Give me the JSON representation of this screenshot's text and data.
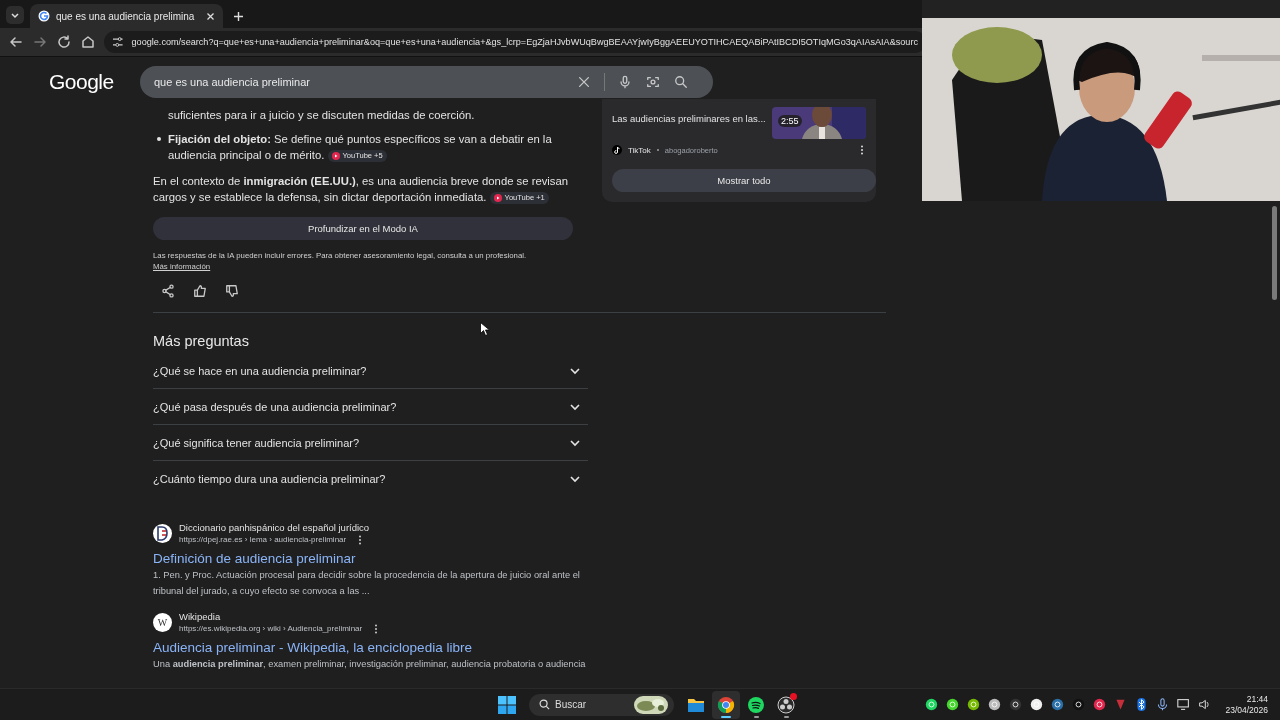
{
  "browser": {
    "tab": {
      "title": "que es una audiencia prelimina",
      "selected": true
    },
    "url": "google.com/search?q=que+es+una+audiencia+preliminar&oq=que+es+una+audiencia+&gs_lcrp=EgZjaHJvbWUqBwgBEAAYjwIyBggAEEUYOTIHCAEQABiPAtIBCDI5OTIqMGo3qAIAsAIA&sourc"
  },
  "logo": "Google",
  "search": {
    "query": "que es una audiencia preliminar"
  },
  "overview": {
    "lines": [
      {
        "kind": "continuation",
        "text": "suficientes para ir a juicio y se discuten medidas de coerción."
      },
      {
        "kind": "bullet",
        "text": "**Fijación del objeto:** Se define qué puntos específicos se van a debatir en la audiencia principal o de mérito.",
        "source": "YouTube +5"
      },
      {
        "kind": "paragraph",
        "text": "En el contexto de **inmigración (EE.UU.)**, es una audiencia breve donde se revisan cargos y se establece la defensa, sin dictar deportación inmediata.",
        "source": "YouTube +1"
      }
    ],
    "deep_button": "Profundizar en el Modo IA",
    "disclaimer": "Las respuestas de la IA pueden incluir errores. Para obtener asesoramiento legal, consulta a un profesional.",
    "more_link": "Más información"
  },
  "video_card": {
    "title": "Las audiencias preliminares en las...",
    "duration": "2:55",
    "platform": "TikTok",
    "author": "abogadoroberto",
    "show_all": "Mostrar todo"
  },
  "questions": {
    "title": "Más preguntas",
    "items": [
      {
        "text": "¿Qué se hace en una audiencia preliminar?",
        "expanded": false
      },
      {
        "text": "¿Qué pasa después de una audiencia preliminar?",
        "expanded": false
      },
      {
        "text": "¿Qué significa tener audiencia preliminar?",
        "expanded": false
      },
      {
        "text": "¿Cuánto tiempo dura una audiencia preliminar?",
        "expanded": false
      }
    ]
  },
  "results": [
    {
      "kind": "dictionary",
      "site": "Diccionario panhispánico del español jurídico",
      "url": "https://dpej.rae.es › lema › audiencia-preliminar",
      "title": "Definición de audiencia preliminar",
      "snippet": "1. Pen. y Proc. Actuación procesal para decidir sobre la procedencia de la apertura de juicio oral ante el tribunal del jurado, a cuyo efecto se convoca a las ..."
    },
    {
      "kind": "wiki",
      "logo_text": "W",
      "site": "Wikipedia",
      "url": "https://es.wikipedia.org › wiki › Audiencia_preliminar",
      "title": "Audiencia preliminar - Wikipedia, la enciclopedia libre",
      "snippet": "Una **audiencia preliminar**, examen preliminar, investigación preliminar, audiencia probatoria o audiencia"
    }
  ],
  "taskbar": {
    "search_placeholder": "Buscar",
    "apps": [
      {
        "kind": "explorer",
        "selected": false,
        "running": false,
        "notification": false
      },
      {
        "kind": "chrome",
        "selected": true,
        "running": true,
        "notification": false
      },
      {
        "kind": "spotify",
        "selected": false,
        "running": true,
        "notification": false
      },
      {
        "kind": "obs",
        "selected": false,
        "running": true,
        "notification": true
      }
    ],
    "tray": [
      {
        "kind": "spotify"
      },
      {
        "kind": "razer"
      },
      {
        "kind": "nvidia"
      },
      {
        "kind": "gear"
      },
      {
        "kind": "obs"
      },
      {
        "kind": "discord"
      },
      {
        "kind": "steam"
      },
      {
        "kind": "logitech"
      },
      {
        "kind": "app"
      },
      {
        "kind": "shield"
      },
      {
        "kind": "bluetooth"
      },
      {
        "kind": "microphone"
      },
      {
        "kind": "display"
      },
      {
        "kind": "speaker"
      }
    ],
    "time": "21:44",
    "date": "23/04/2026"
  }
}
